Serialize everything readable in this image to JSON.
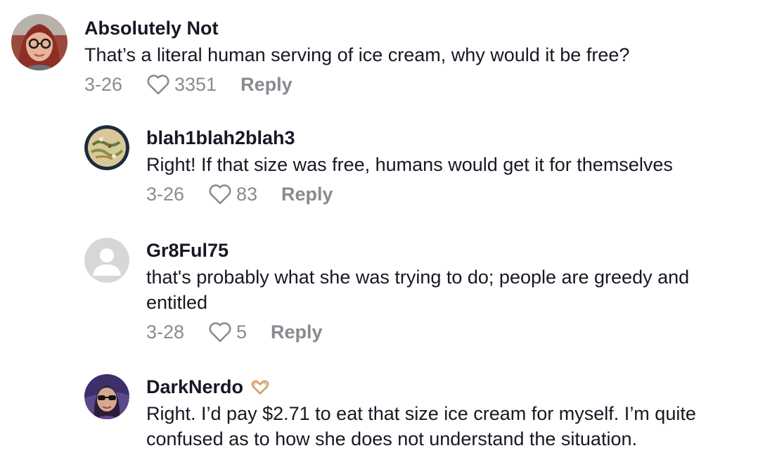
{
  "comments": [
    {
      "username": "Absolutely Not",
      "text": "That’s a literal human serving of ice cream, why would it be free?",
      "date": "3-26",
      "likes": "3351",
      "reply_label": "Reply",
      "avatar_icon": "user-photo-glasses"
    },
    {
      "username": "blah1blah2blah3",
      "text": "Right! If that size was free, humans would get it for themselves",
      "date": "3-26",
      "likes": "83",
      "reply_label": "Reply",
      "avatar_icon": "user-photo-food"
    },
    {
      "username": "Gr8Ful75",
      "text": "that's probably what she was trying to do; people are greedy and entitled",
      "date": "3-28",
      "likes": "5",
      "reply_label": "Reply",
      "avatar_icon": "default-avatar"
    },
    {
      "username": "DarkNerdo",
      "badge_icon": "heart-hands-emoji",
      "text": "Right. I’d pay $2.71 to eat that size ice cream for myself. I’m quite confused as to how she does not understand the situation.",
      "avatar_icon": "user-photo-sunglasses"
    }
  ],
  "colors": {
    "primary_text": "#161823",
    "secondary_text": "#8a8b91",
    "background": "#ffffff"
  }
}
